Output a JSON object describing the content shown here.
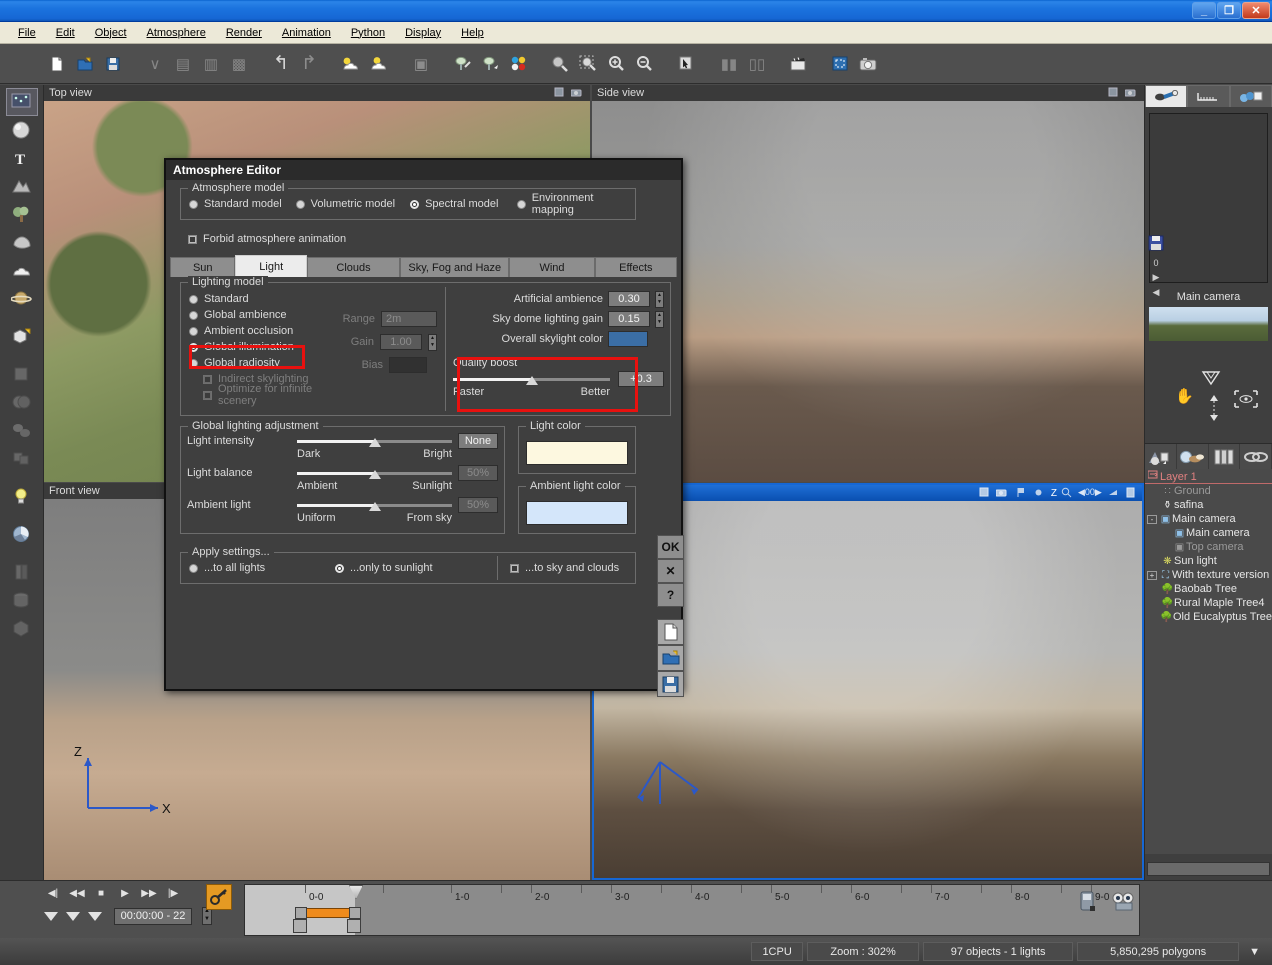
{
  "window": {
    "title": "",
    "min_label": "_",
    "restore_label": "❐",
    "close_label": "✕"
  },
  "menubar": {
    "items": [
      "File",
      "Edit",
      "Object",
      "Atmosphere",
      "Render",
      "Animation",
      "Python",
      "Display",
      "Help"
    ]
  },
  "toolbar": {
    "items": [
      {
        "name": "new-document-icon",
        "glyph": "🗋"
      },
      {
        "name": "open-folder-icon",
        "glyph": "📂"
      },
      {
        "name": "save-disk-icon",
        "glyph": "💾"
      },
      {
        "name": "merge-icon",
        "glyph": "∨"
      },
      {
        "name": "copy-icon",
        "glyph": "▤"
      },
      {
        "name": "paste-icon",
        "glyph": "▥"
      },
      {
        "name": "duplicate-icon",
        "glyph": "▩"
      },
      {
        "name": "undo-icon",
        "glyph": "↶"
      },
      {
        "name": "redo-icon",
        "glyph": "↷"
      },
      {
        "name": "atmosphere-add-icon",
        "glyph": "☁"
      },
      {
        "name": "atmosphere-icon",
        "glyph": "☁"
      },
      {
        "name": "object-icon",
        "glyph": "▣"
      },
      {
        "name": "material-edit-icon",
        "glyph": "◍"
      },
      {
        "name": "material-icon",
        "glyph": "◐"
      },
      {
        "name": "color-palette-icon",
        "glyph": "⬤"
      },
      {
        "name": "render-preview-icon",
        "glyph": "◗"
      },
      {
        "name": "zoom-region-icon",
        "glyph": "🔍"
      },
      {
        "name": "zoom-in-icon",
        "glyph": "+"
      },
      {
        "name": "zoom-out-icon",
        "glyph": "−"
      },
      {
        "name": "select-arrow-icon",
        "glyph": "↖"
      },
      {
        "name": "film-strip-icon",
        "glyph": "▮▮"
      },
      {
        "name": "film-strip2-icon",
        "glyph": "▯▯"
      },
      {
        "name": "clapper-icon",
        "glyph": "🎬"
      },
      {
        "name": "render-area-icon",
        "glyph": "▢"
      },
      {
        "name": "camera-render-icon",
        "glyph": "📷"
      }
    ]
  },
  "left_toolbar": {
    "items": [
      {
        "name": "terrain-tool",
        "glyph": "▦",
        "selected": true,
        "dim": false
      },
      {
        "name": "sphere-primitive-tool",
        "glyph": "●",
        "selected": false,
        "dim": false
      },
      {
        "name": "text-tool",
        "glyph": "T",
        "selected": false,
        "dim": false
      },
      {
        "name": "rock-tool",
        "glyph": "⛰",
        "selected": false,
        "dim": false
      },
      {
        "name": "tree-tool",
        "glyph": "🌲",
        "selected": false,
        "dim": false
      },
      {
        "name": "stone-tool",
        "glyph": "⬬",
        "selected": false,
        "dim": false
      },
      {
        "name": "cloud-tool",
        "glyph": "☁",
        "selected": false,
        "dim": false
      },
      {
        "name": "planet-tool",
        "glyph": "🪐",
        "selected": false,
        "dim": false
      },
      {
        "name": "add-object-tool",
        "glyph": "▣",
        "selected": false,
        "dim": false
      },
      {
        "name": "boolean-union-tool",
        "glyph": "▨",
        "selected": false,
        "dim": true
      },
      {
        "name": "boolean-intersect-tool",
        "glyph": "◍",
        "selected": false,
        "dim": true
      },
      {
        "name": "metaball-tool",
        "glyph": "⬮",
        "selected": false,
        "dim": true
      },
      {
        "name": "group-tool",
        "glyph": "▩",
        "selected": false,
        "dim": true
      },
      {
        "name": "light-tool",
        "glyph": "💡",
        "selected": false,
        "dim": false
      },
      {
        "name": "camera-tool",
        "glyph": "◉",
        "selected": false,
        "dim": false
      },
      {
        "name": "column-tool",
        "glyph": "▯",
        "selected": false,
        "dim": true
      },
      {
        "name": "cylinder-tool",
        "glyph": "⬭",
        "selected": false,
        "dim": true
      },
      {
        "name": "cube-tool",
        "glyph": "⬛",
        "selected": false,
        "dim": true
      }
    ]
  },
  "viewports": [
    {
      "name": "top-view",
      "title": "Top view",
      "active": false
    },
    {
      "name": "side-view",
      "title": "Side view",
      "active": false
    },
    {
      "name": "front-view",
      "title": "Front view",
      "active": false
    },
    {
      "name": "camera-view",
      "title": "",
      "active": true
    }
  ],
  "right_panel": {
    "tabs": [
      {
        "name": "tab-material-editor",
        "glyph": "⚲",
        "active": true
      },
      {
        "name": "tab-measure",
        "glyph": "📏",
        "active": false
      },
      {
        "name": "tab-objects",
        "glyph": "◲",
        "active": false
      }
    ],
    "camera_label": "Main camera",
    "nav_icons": [
      {
        "name": "pan-hand-icon",
        "glyph": "✋"
      },
      {
        "name": "orbit-icon",
        "glyph": "▽"
      },
      {
        "name": "move-updown-icon",
        "glyph": "↕"
      },
      {
        "name": "look-eye-icon",
        "glyph": "👁"
      }
    ],
    "side_icons": [
      {
        "name": "save-view-icon",
        "glyph": "💾"
      },
      {
        "name": "zero-label",
        "glyph": "0"
      },
      {
        "name": "play-view-icon",
        "glyph": "▶"
      },
      {
        "name": "prev-view-icon",
        "glyph": "◀"
      }
    ],
    "icon_bar": [
      {
        "name": "atmosphere-browser-icon",
        "glyph": "⛰"
      },
      {
        "name": "material-browser-icon",
        "glyph": "◒"
      },
      {
        "name": "library-icon",
        "glyph": "▮▮▮"
      },
      {
        "name": "link-browser-icon",
        "glyph": "⛓"
      }
    ],
    "tree": {
      "layer": "Layer 1",
      "items": [
        {
          "label": "Ground",
          "icon": "dots-icon",
          "indent": 1,
          "toggle": "",
          "dim": true
        },
        {
          "label": "safina",
          "icon": "trophy-icon",
          "indent": 1,
          "toggle": "",
          "dim": false
        },
        {
          "label": "Main camera",
          "icon": "camera-icon",
          "indent": 0,
          "toggle": "-",
          "dim": false
        },
        {
          "label": "Main camera",
          "icon": "camera-icon",
          "indent": 2,
          "toggle": "",
          "dim": false
        },
        {
          "label": "Top camera",
          "icon": "camera-icon",
          "indent": 2,
          "toggle": "",
          "dim": true
        },
        {
          "label": "Sun light",
          "icon": "sun-icon",
          "indent": 1,
          "toggle": "",
          "dim": false
        },
        {
          "label": "With texture version",
          "icon": "group-icon",
          "indent": 0,
          "toggle": "+",
          "dim": false
        },
        {
          "label": "Baobab Tree",
          "icon": "tree-icon",
          "indent": 1,
          "toggle": "",
          "dim": false
        },
        {
          "label": "Rural Maple Tree4",
          "icon": "tree-icon",
          "indent": 1,
          "toggle": "",
          "dim": false
        },
        {
          "label": "Old Eucalyptus Tree",
          "icon": "tree-icon",
          "indent": 1,
          "toggle": "",
          "dim": false
        }
      ]
    }
  },
  "timeline": {
    "transport": [
      {
        "name": "go-to-start-button",
        "glyph": "◀|"
      },
      {
        "name": "step-back-button",
        "glyph": "◀◀"
      },
      {
        "name": "stop-button",
        "glyph": "■"
      },
      {
        "name": "play-button",
        "glyph": "▶"
      },
      {
        "name": "fast-forward-button",
        "glyph": "▶▶"
      },
      {
        "name": "go-to-end-button",
        "glyph": "|▶"
      }
    ],
    "keyframe_buttons": [
      {
        "name": "prev-key-button",
        "glyph": "▼"
      },
      {
        "name": "add-key-button",
        "glyph": "▼"
      },
      {
        "name": "next-key-button",
        "glyph": "▼"
      }
    ],
    "time_value": "00:00:00 - 22",
    "keyframer_icon": "key-icon",
    "tick_labels": [
      "0-0",
      "1-0",
      "2-0",
      "3-0",
      "4-0",
      "5-0",
      "6-0",
      "7-0",
      "8-0",
      "9-0"
    ],
    "bottom_tools": [
      {
        "name": "render-animation-icon",
        "glyph": "🎞"
      },
      {
        "name": "camera-animation-icon",
        "glyph": "📷"
      }
    ]
  },
  "statusbar": {
    "cpu": "1CPU",
    "zoom": "Zoom : 302%",
    "objects": "97 objects - 1 lights",
    "polygons": "5,850,295 polygons",
    "dropdown_glyph": "▼"
  },
  "dialog": {
    "title": "Atmosphere Editor",
    "atmosphere_model": {
      "legend": "Atmosphere model",
      "options": [
        {
          "label": "Standard model",
          "selected": false
        },
        {
          "label": "Volumetric model",
          "selected": false
        },
        {
          "label": "Spectral model",
          "selected": true
        },
        {
          "label": "Environment mapping",
          "selected": false
        }
      ]
    },
    "forbid_animation": {
      "label": "Forbid atmosphere animation",
      "checked": false
    },
    "tabs": [
      {
        "label": "Sun",
        "active": false
      },
      {
        "label": "Light",
        "active": true
      },
      {
        "label": "Clouds",
        "active": false
      },
      {
        "label": "Sky, Fog and Haze",
        "active": false
      },
      {
        "label": "Wind",
        "active": false
      },
      {
        "label": "Effects",
        "active": false
      }
    ],
    "lighting_model": {
      "legend": "Lighting model",
      "options": [
        {
          "label": "Standard",
          "selected": false,
          "dim": false
        },
        {
          "label": "Global ambience",
          "selected": false,
          "dim": false
        },
        {
          "label": "Ambient occlusion",
          "selected": false,
          "dim": false
        },
        {
          "label": "Global illumination",
          "selected": true,
          "dim": false
        },
        {
          "label": "Global radiosity",
          "selected": false,
          "dim": false
        }
      ],
      "checks": [
        {
          "label": "Indirect skylighting",
          "checked": true,
          "dim": true
        },
        {
          "label": "Optimize for infinite scenery",
          "checked": true,
          "dim": true
        }
      ],
      "fields": [
        {
          "label": "Range",
          "value": "2m",
          "dim": true,
          "spinner": false
        },
        {
          "label": "Gain",
          "value": "1.00",
          "dim": true,
          "spinner": true
        },
        {
          "label": "Bias",
          "value": "",
          "dim": true,
          "spinner": false,
          "dark": true
        }
      ]
    },
    "right_fields": [
      {
        "label": "Artificial ambience",
        "value": "0.30",
        "spinner": true
      },
      {
        "label": "Sky dome lighting gain",
        "value": "0.15",
        "spinner": true
      }
    ],
    "overall_skylight": {
      "label": "Overall skylight color",
      "color": "#3b6ea5"
    },
    "quality_boost": {
      "legend": "Quality boost",
      "value": "+0.3",
      "left_label": "Faster",
      "right_label": "Better",
      "position_pct": 50
    },
    "global_lighting": {
      "legend": "Global lighting adjustment",
      "sliders": [
        {
          "label": "Light intensity",
          "left": "Dark",
          "right": "Bright",
          "value": "None",
          "position_pct": 50,
          "dim": false
        },
        {
          "label": "Light balance",
          "left": "Ambient",
          "right": "Sunlight",
          "value": "50%",
          "position_pct": 50,
          "dim": true
        },
        {
          "label": "Ambient light",
          "left": "Uniform",
          "right": "From sky",
          "value": "50%",
          "position_pct": 50,
          "dim": true
        }
      ]
    },
    "light_color": {
      "legend": "Light color",
      "color": "#fdf8e0"
    },
    "ambient_light_color": {
      "legend": "Ambient light color",
      "color": "#d4e6fa"
    },
    "apply_settings": {
      "legend": "Apply settings...",
      "options": [
        {
          "type": "radio",
          "label": "...to all lights",
          "selected": false
        },
        {
          "type": "radio",
          "label": "...only to sunlight",
          "selected": true
        },
        {
          "type": "check",
          "label": "...to sky and clouds",
          "checked": false
        }
      ]
    },
    "buttons": [
      {
        "name": "ok-button",
        "label": "OK"
      },
      {
        "name": "cancel-button",
        "label": "✕"
      },
      {
        "name": "help-button",
        "label": "?"
      }
    ],
    "file_buttons": [
      {
        "name": "new-preset-button",
        "glyph": "🗋"
      },
      {
        "name": "load-preset-button",
        "glyph": "📂"
      },
      {
        "name": "save-preset-button",
        "glyph": "💾"
      }
    ]
  },
  "colors": {
    "highlight": "#e8110f",
    "accent_blue": "#1667d4"
  }
}
